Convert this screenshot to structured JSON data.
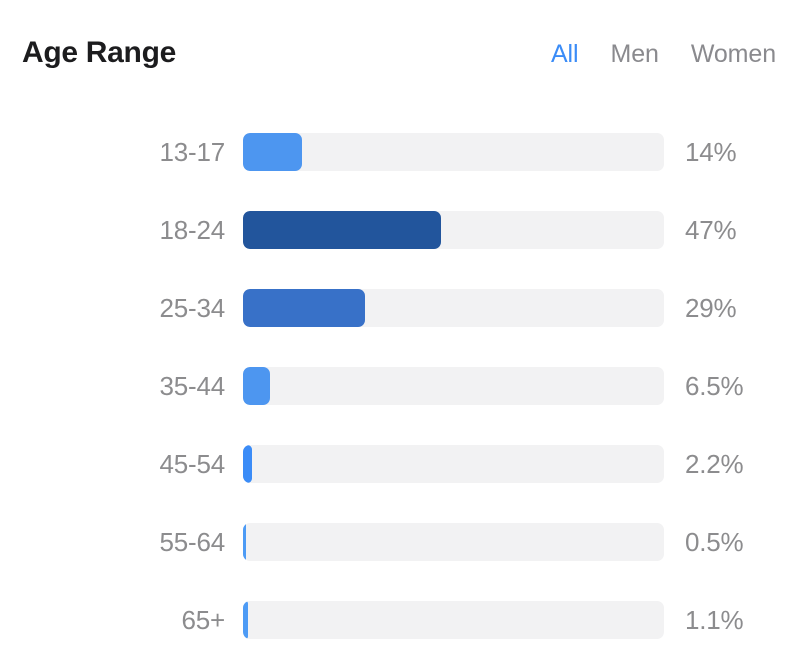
{
  "header": {
    "title": "Age Range",
    "tabs": [
      {
        "label": "All",
        "active": true
      },
      {
        "label": "Men",
        "active": false
      },
      {
        "label": "Women",
        "active": false
      }
    ]
  },
  "colors": {
    "accent": "#3b8cf7",
    "track": "#f2f2f3",
    "label": "#8c8c8e",
    "title": "#1c1c1e",
    "background": "#ffffff"
  },
  "chart_data": {
    "type": "bar",
    "title": "Age Range",
    "xlabel": "",
    "ylabel": "",
    "orientation": "horizontal",
    "grid": false,
    "legend": false,
    "xlim": [
      0,
      100
    ],
    "unit": "%",
    "axis_max_percent": 100,
    "categories": [
      "13-17",
      "18-24",
      "25-34",
      "35-44",
      "45-54",
      "55-64",
      "65+"
    ],
    "values": [
      14,
      47,
      29,
      6.5,
      2.2,
      0.5,
      1.1
    ],
    "value_labels": [
      "14%",
      "47%",
      "29%",
      "6.5%",
      "2.2%",
      "0.5%",
      "1.1%"
    ],
    "bar_colors": [
      "#4d96f0",
      "#22559c",
      "#3871c8",
      "#4d96f0",
      "#3b8cf7",
      "#4d9bf5",
      "#4d9bf5"
    ],
    "rows": [
      {
        "label": "13-17",
        "value": 14,
        "value_label": "14%",
        "color": "#4d96f0"
      },
      {
        "label": "18-24",
        "value": 47,
        "value_label": "47%",
        "color": "#22559c"
      },
      {
        "label": "25-34",
        "value": 29,
        "value_label": "29%",
        "color": "#3871c8"
      },
      {
        "label": "35-44",
        "value": 6.5,
        "value_label": "6.5%",
        "color": "#4d96f0"
      },
      {
        "label": "45-54",
        "value": 2.2,
        "value_label": "2.2%",
        "color": "#3b8cf7"
      },
      {
        "label": "55-64",
        "value": 0.5,
        "value_label": "0.5%",
        "color": "#4d9bf5"
      },
      {
        "label": "65+",
        "value": 1.1,
        "value_label": "1.1%",
        "color": "#4d9bf5"
      }
    ]
  }
}
